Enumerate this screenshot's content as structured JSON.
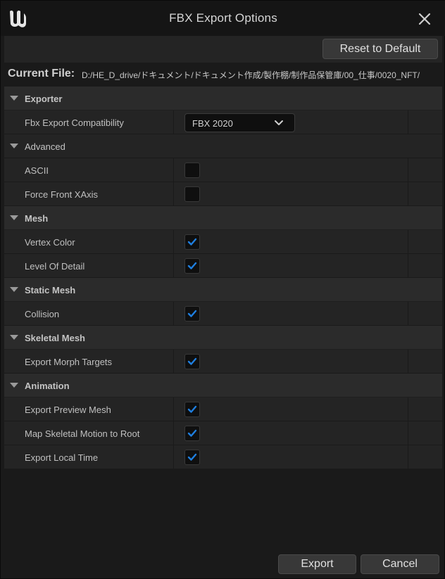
{
  "window": {
    "title": "FBX Export Options"
  },
  "toolbar": {
    "reset_label": "Reset to Default"
  },
  "file": {
    "label": "Current File:",
    "path": "D:/HE_D_drive/ドキュメント/ドキュメント作成/製作棚/制作品保管庫/00_仕事/0020_NFT/"
  },
  "colors": {
    "accent": "#1f7fe0",
    "panel_bg": "#242424",
    "category_bg": "#2b2b2b"
  },
  "details": {
    "exporter": {
      "label": "Exporter",
      "compatibility_label": "Fbx Export Compatibility",
      "compatibility_value": "FBX 2020"
    },
    "advanced": {
      "label": "Advanced",
      "ascii_label": "ASCII",
      "ascii_checked": false,
      "force_front_label": "Force Front XAxis",
      "force_front_checked": false
    },
    "mesh": {
      "label": "Mesh",
      "vertex_color_label": "Vertex Color",
      "vertex_color_checked": true,
      "lod_label": "Level Of Detail",
      "lod_checked": true
    },
    "static_mesh": {
      "label": "Static Mesh",
      "collision_label": "Collision",
      "collision_checked": true
    },
    "skeletal_mesh": {
      "label": "Skeletal Mesh",
      "morph_label": "Export Morph Targets",
      "morph_checked": true
    },
    "animation": {
      "label": "Animation",
      "preview_mesh_label": "Export Preview Mesh",
      "preview_mesh_checked": true,
      "root_motion_label": "Map Skeletal Motion to Root",
      "root_motion_checked": true,
      "local_time_label": "Export Local Time",
      "local_time_checked": true
    }
  },
  "footer": {
    "export_label": "Export",
    "cancel_label": "Cancel"
  }
}
